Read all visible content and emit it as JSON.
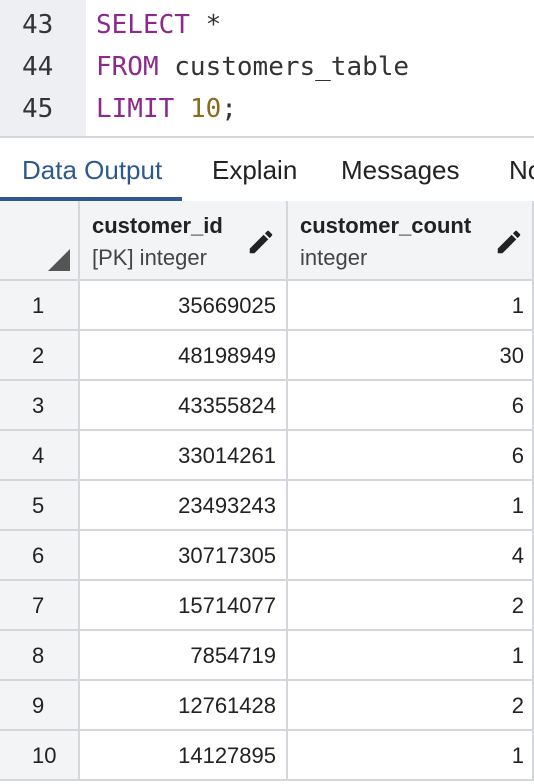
{
  "editor": {
    "lines": [
      {
        "num": "43",
        "kw": "SELECT",
        "rest": " *",
        "numlit": "",
        "tail": ""
      },
      {
        "num": "44",
        "kw": "FROM",
        "rest": " customers_table",
        "numlit": "",
        "tail": ""
      },
      {
        "num": "45",
        "kw": "LIMIT",
        "rest": " ",
        "numlit": "10",
        "tail": ";"
      }
    ]
  },
  "tabs": {
    "data_output": "Data Output",
    "explain": "Explain",
    "messages": "Messages",
    "notifications": "No"
  },
  "grid": {
    "columns": [
      {
        "name": "customer_id",
        "type": "[PK] integer"
      },
      {
        "name": "customer_count",
        "type": "integer"
      }
    ],
    "rows": [
      [
        "1",
        "35669025",
        "1"
      ],
      [
        "2",
        "48198949",
        "30"
      ],
      [
        "3",
        "43355824",
        "6"
      ],
      [
        "4",
        "33014261",
        "6"
      ],
      [
        "5",
        "23493243",
        "1"
      ],
      [
        "6",
        "30717305",
        "4"
      ],
      [
        "7",
        "15714077",
        "2"
      ],
      [
        "8",
        "7854719",
        "1"
      ],
      [
        "9",
        "12761428",
        "2"
      ],
      [
        "10",
        "14127895",
        "1"
      ]
    ]
  }
}
